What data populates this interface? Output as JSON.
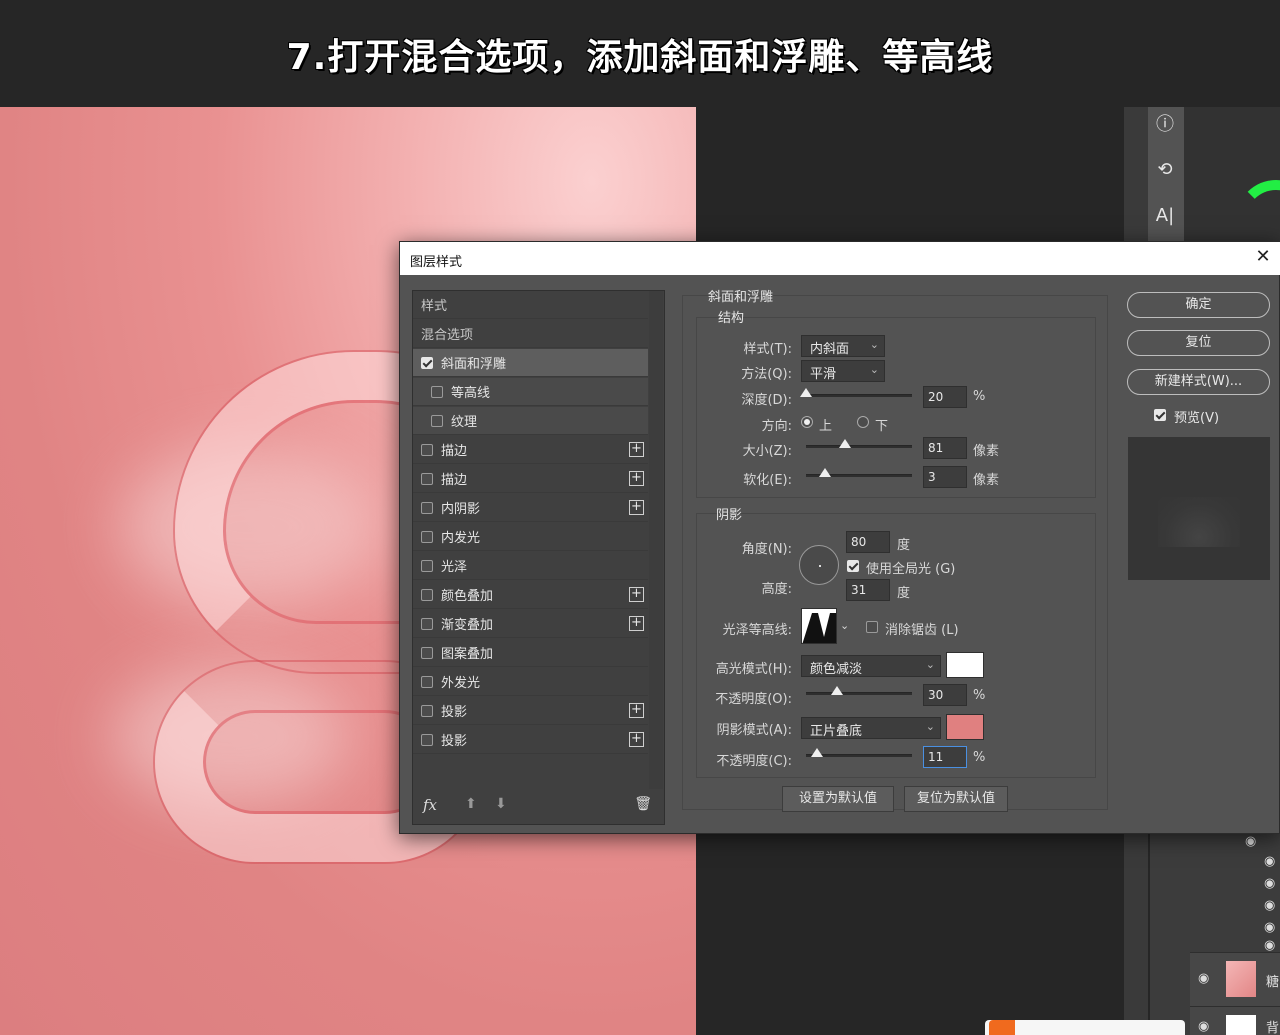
{
  "banner": {
    "text": "7.打开混合选项，添加斜面和浮雕、等高线"
  },
  "dialog": {
    "title": "图层样式",
    "left_list": {
      "items": [
        {
          "label": "样式",
          "type": "head"
        },
        {
          "label": "混合选项",
          "type": "head"
        },
        {
          "label": "斜面和浮雕",
          "checked": true,
          "selected": true
        },
        {
          "label": "等高线",
          "checked": false,
          "sub": true
        },
        {
          "label": "纹理",
          "checked": false,
          "sub": true
        },
        {
          "label": "描边",
          "checked": false,
          "plus": true
        },
        {
          "label": "描边",
          "checked": false,
          "plus": true
        },
        {
          "label": "内阴影",
          "checked": false,
          "plus": true
        },
        {
          "label": "内发光",
          "checked": false
        },
        {
          "label": "光泽",
          "checked": false
        },
        {
          "label": "颜色叠加",
          "checked": false,
          "plus": true
        },
        {
          "label": "渐变叠加",
          "checked": false,
          "plus": true
        },
        {
          "label": "图案叠加",
          "checked": false
        },
        {
          "label": "外发光",
          "checked": false
        },
        {
          "label": "投影",
          "checked": false,
          "plus": true
        },
        {
          "label": "投影",
          "checked": false,
          "plus": true
        }
      ],
      "fx_label": "fx"
    },
    "bevel": {
      "group_title": "斜面和浮雕",
      "structure_title": "结构",
      "style_label": "样式(T):",
      "style_value": "内斜面",
      "technique_label": "方法(Q):",
      "technique_value": "平滑",
      "depth_label": "深度(D):",
      "depth_value": "20",
      "depth_unit": "%",
      "direction_label": "方向:",
      "direction_up": "上",
      "direction_down": "下",
      "size_label": "大小(Z):",
      "size_value": "81",
      "size_unit": "像素",
      "soften_label": "软化(E):",
      "soften_value": "3",
      "soften_unit": "像素"
    },
    "shading": {
      "title": "阴影",
      "angle_label": "角度(N):",
      "angle_value": "80",
      "angle_unit": "度",
      "global_light_label": "使用全局光 (G)",
      "altitude_label": "高度:",
      "altitude_value": "31",
      "altitude_unit": "度",
      "gloss_contour_label": "光泽等高线:",
      "antialias_label": "消除锯齿 (L)",
      "highlight_mode_label": "高光模式(H):",
      "highlight_mode_value": "颜色减淡",
      "highlight_color": "#ffffff",
      "highlight_opacity_label": "不透明度(O):",
      "highlight_opacity_value": "30",
      "highlight_opacity_unit": "%",
      "shadow_mode_label": "阴影模式(A):",
      "shadow_mode_value": "正片叠底",
      "shadow_color": "#e08080",
      "shadow_opacity_label": "不透明度(C):",
      "shadow_opacity_value": "11",
      "shadow_opacity_unit": "%"
    },
    "set_default": "设置为默认值",
    "reset_default": "复位为默认值",
    "ok": "确定",
    "reset": "复位",
    "new_style": "新建样式(W)...",
    "preview_label": "预览(V)"
  },
  "right_panel": {
    "layer1_name": "糖",
    "layer2_name": "背"
  }
}
